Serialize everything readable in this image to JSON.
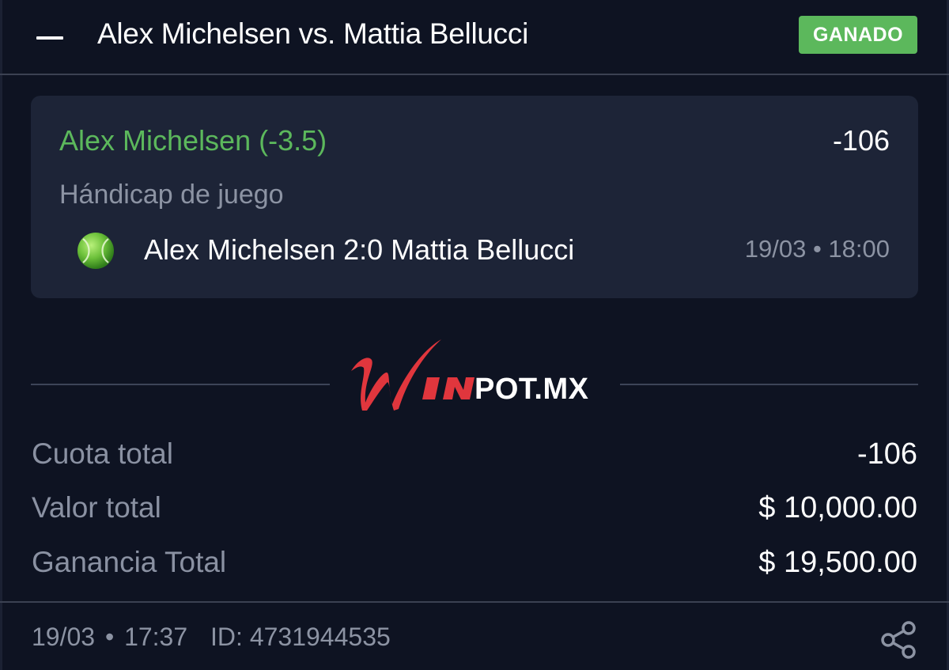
{
  "header": {
    "title": "Alex Michelsen vs. Mattia Bellucci",
    "status_badge": "GANADO"
  },
  "bet": {
    "selection": "Alex Michelsen (-3.5)",
    "odds": "-106",
    "market": "Hándicap de juego",
    "sport_icon": "tennis-ball-icon",
    "match": "Alex Michelsen 2:0 Mattia Bellucci",
    "match_time": "19/03 • 18:00"
  },
  "brand": {
    "logo_text": "WINPOT.MX"
  },
  "summary": {
    "rows": [
      {
        "label": "Cuota total",
        "value": "-106"
      },
      {
        "label": "Valor total",
        "value": "$ 10,000.00"
      },
      {
        "label": "Ganancia Total",
        "value": "$ 19,500.00"
      }
    ]
  },
  "footer": {
    "date": "19/03",
    "separator": "•",
    "time": "17:37",
    "id_text": "ID: 4731944535",
    "share_icon": "share-icon"
  },
  "colors": {
    "background": "#0e1322",
    "card": "#1d2437",
    "win_green": "#5cb85c",
    "muted_text": "#8c93a3",
    "brand_red": "#e0363d"
  }
}
